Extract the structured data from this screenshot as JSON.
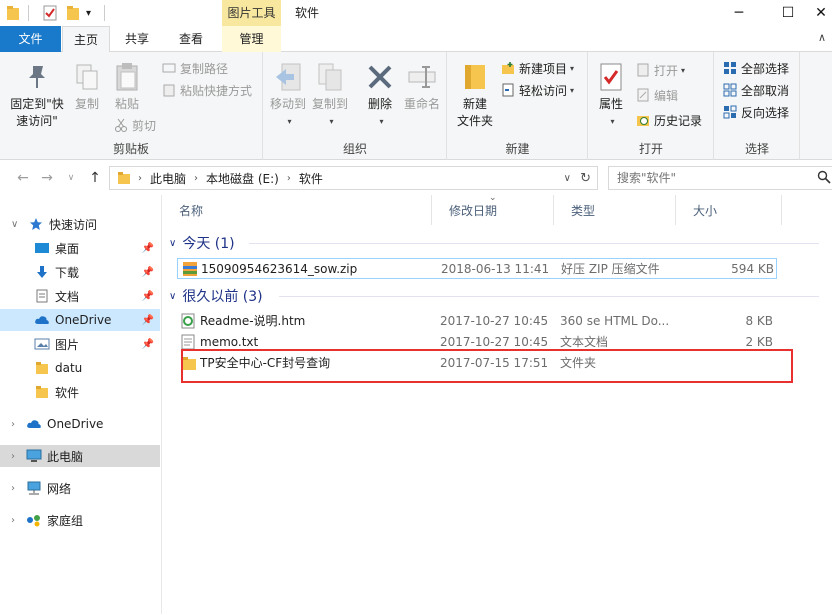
{
  "window": {
    "title": "软件",
    "contextual_tab": "图片工具",
    "controls": {
      "minimize": "─",
      "maximize": "☐",
      "close": "✕"
    }
  },
  "ribbon_tabs": [
    "文件",
    "主页",
    "共享",
    "查看",
    "管理"
  ],
  "ribbon": {
    "clipboard": {
      "label": "剪贴板",
      "pin_quick_access": "固定到\"快速访问\"",
      "copy": "复制",
      "paste": "粘贴",
      "copy_path": "复制路径",
      "paste_shortcut": "粘贴快捷方式",
      "cut": "剪切"
    },
    "organize": {
      "label": "组织",
      "move_to": "移动到",
      "copy_to": "复制到",
      "delete": "删除",
      "rename": "重命名"
    },
    "new": {
      "label": "新建",
      "new_folder": "新建\n文件夹",
      "new_item": "新建项目",
      "easy_access": "轻松访问"
    },
    "open": {
      "label": "打开",
      "properties": "属性",
      "open": "打开",
      "edit": "编辑",
      "history": "历史记录"
    },
    "select": {
      "label": "选择",
      "select_all": "全部选择",
      "select_none": "全部取消",
      "invert": "反向选择"
    }
  },
  "address": {
    "crumbs": [
      "此电脑",
      "本地磁盘 (E:)",
      "软件"
    ],
    "search_placeholder": "搜索\"软件\""
  },
  "nav": {
    "quick_access": "快速访问",
    "items": [
      {
        "label": "桌面",
        "pinned": true
      },
      {
        "label": "下载",
        "pinned": true
      },
      {
        "label": "文档",
        "pinned": true
      },
      {
        "label": "OneDrive",
        "pinned": true
      },
      {
        "label": "图片",
        "pinned": true
      },
      {
        "label": "datu",
        "pinned": false
      },
      {
        "label": "软件",
        "pinned": false
      }
    ],
    "onedrive": "OneDrive",
    "this_pc": "此电脑",
    "network": "网络",
    "homegroup": "家庭组"
  },
  "columns": {
    "name": "名称",
    "modified": "修改日期",
    "type": "类型",
    "size": "大小"
  },
  "groups": [
    {
      "header": "今天 (1)",
      "files": [
        {
          "name": "15090954623614_sow.zip",
          "modified": "2018-06-13 11:41",
          "type": "好压 ZIP 压缩文件",
          "size": "594 KB",
          "icon": "zip-icon"
        }
      ]
    },
    {
      "header": "很久以前 (3)",
      "files": [
        {
          "name": "Readme-说明.htm",
          "modified": "2017-10-27 10:45",
          "type": "360 se HTML Do...",
          "size": "8 KB",
          "icon": "html-file-icon"
        },
        {
          "name": "memo.txt",
          "modified": "2017-10-27 10:45",
          "type": "文本文档",
          "size": "2 KB",
          "icon": "text-file-icon"
        },
        {
          "name": "TP安全中心-CF封号查询",
          "modified": "2017-07-15 17:51",
          "type": "文件夹",
          "size": "",
          "icon": "folder-icon"
        }
      ]
    }
  ],
  "colors": {
    "accent": "#1979ca",
    "highlight": "#e8302e",
    "selection": "#cce8ff",
    "context_tab": "#f7e79f"
  }
}
